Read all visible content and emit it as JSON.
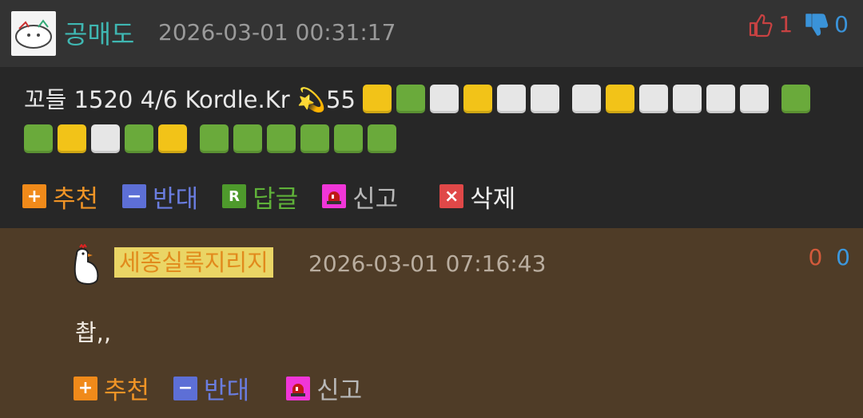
{
  "comment": {
    "author": "공매도",
    "timestamp": "2026-03-01 00:31:17",
    "upvotes": "1",
    "downvotes": "0",
    "text": "꼬들 1520 4/6 Kordle.Kr 💫55",
    "grid_rows": [
      [
        "y",
        "g",
        "w",
        "y",
        "w",
        "w"
      ],
      [
        "w",
        "y",
        "w",
        "w",
        "w",
        "w"
      ],
      [
        "g",
        "g",
        "y",
        "w",
        "g",
        "y"
      ],
      [
        "g",
        "g",
        "g",
        "g",
        "g",
        "g"
      ]
    ],
    "actions": {
      "recommend": "추천",
      "oppose": "반대",
      "reply": "답글",
      "report": "신고",
      "delete": "삭제"
    }
  },
  "reply": {
    "author": "세종실록지리지",
    "timestamp": "2026-03-01 07:16:43",
    "upvotes": "0",
    "downvotes": "0",
    "text": "촵,,",
    "actions": {
      "recommend": "추천",
      "oppose": "반대",
      "report": "신고"
    }
  },
  "colors": {
    "header_bg": "#333333",
    "main_bg": "#272727",
    "reply_bg": "#4f3c27",
    "accent_teal": "#3fb7b2",
    "highlight": "#ead565"
  },
  "icons": [
    "thumbs-up-icon",
    "thumbs-down-icon",
    "plus-icon",
    "minus-icon",
    "reply-r-icon",
    "alarm-icon",
    "delete-x-icon"
  ]
}
